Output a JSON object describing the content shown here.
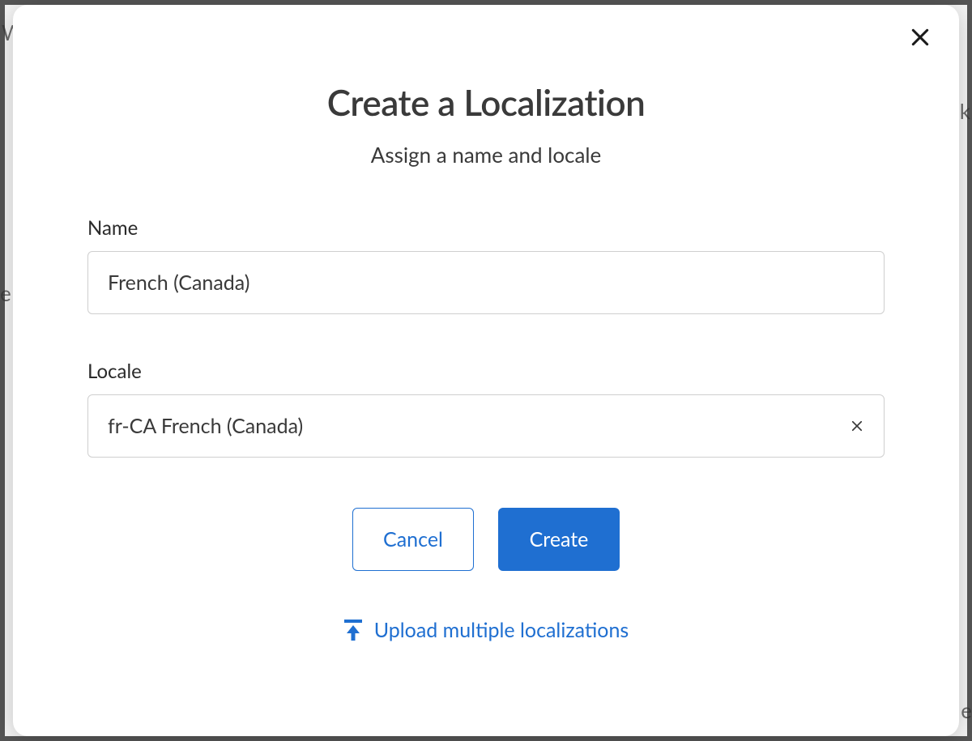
{
  "modal": {
    "title": "Create a Localization",
    "subtitle": "Assign a name and locale",
    "fields": {
      "name": {
        "label": "Name",
        "value": "French (Canada)"
      },
      "locale": {
        "label": "Locale",
        "value": "fr-CA French (Canada)"
      }
    },
    "buttons": {
      "cancel": "Cancel",
      "create": "Create"
    },
    "upload_link": "Upload multiple localizations"
  },
  "colors": {
    "primary": "#1f6fd1",
    "text": "#3a3a3a",
    "border": "#cfcfcf"
  }
}
